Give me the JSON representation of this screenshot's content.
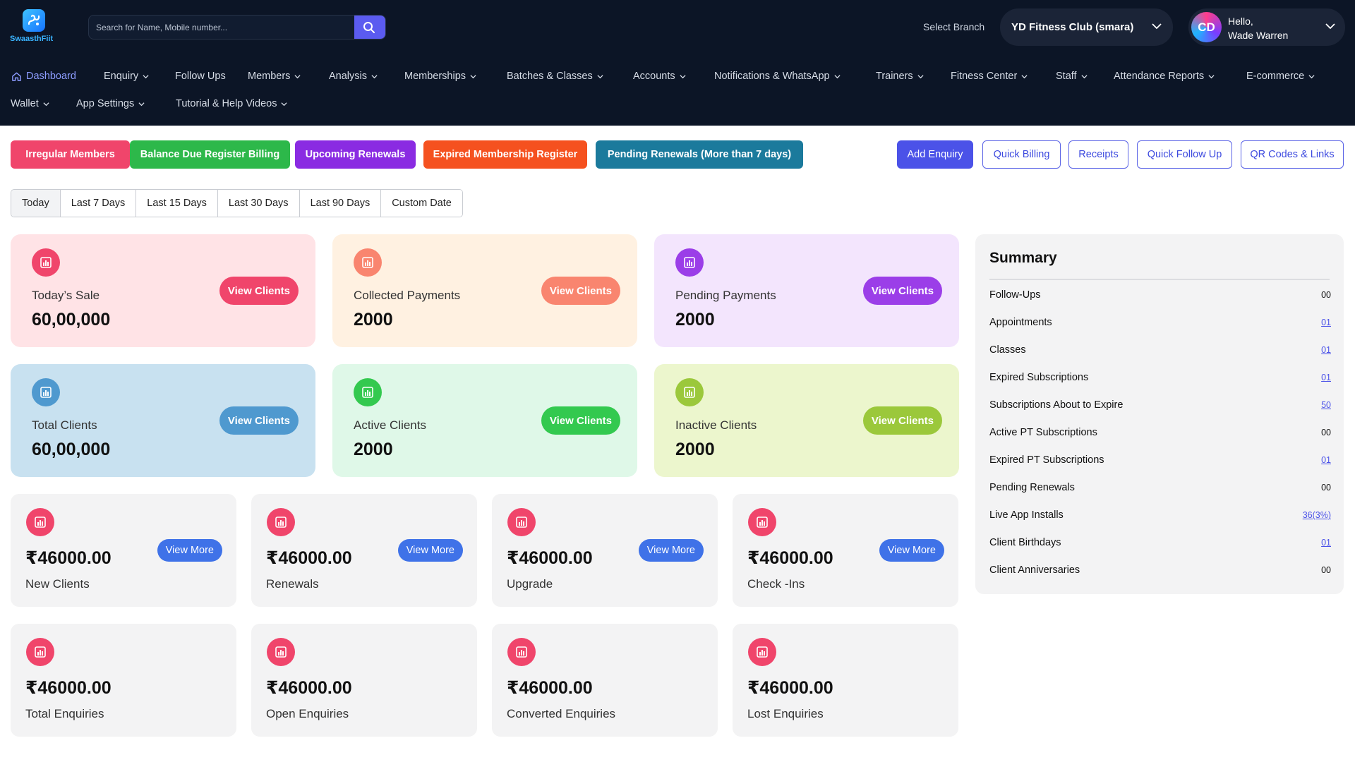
{
  "brand": {
    "name": "SwaasthFiit"
  },
  "search": {
    "placeholder": "Search for Name, Mobile number..."
  },
  "branch": {
    "label": "Select Branch",
    "value": "YD Fitness Club (smara)"
  },
  "user": {
    "initials": "CD",
    "greeting": "Hello,",
    "name": "Wade Warren"
  },
  "nav": [
    {
      "label": "Dashboard",
      "caret": false
    },
    {
      "label": "Enquiry",
      "caret": true
    },
    {
      "label": "Follow Ups",
      "caret": false
    },
    {
      "label": "Members",
      "caret": true
    },
    {
      "label": "Analysis",
      "caret": true
    },
    {
      "label": "Memberships",
      "caret": true
    },
    {
      "label": "Batches & Classes",
      "caret": true
    },
    {
      "label": "Accounts",
      "caret": true
    },
    {
      "label": "Notifications & WhatsApp",
      "caret": true
    },
    {
      "label": "Trainers",
      "caret": true
    },
    {
      "label": "Fitness Center",
      "caret": true
    },
    {
      "label": "Staff",
      "caret": true
    },
    {
      "label": "Attendance Reports",
      "caret": true
    },
    {
      "label": "E-commerce",
      "caret": true
    },
    {
      "label": "Wallet",
      "caret": true
    },
    {
      "label": "App Settings",
      "caret": true
    },
    {
      "label": "Tutorial & Help Videos",
      "caret": true
    }
  ],
  "quick_links": [
    {
      "label": "Irregular Members",
      "color": "#f0456b"
    },
    {
      "label": "Balance Due Register Billing",
      "color": "#2db84a"
    },
    {
      "label": "Upcoming Renewals",
      "color": "#8a2be2"
    },
    {
      "label": "Expired Membership Register",
      "color": "#f5511f"
    },
    {
      "label": "Pending Renewals (More than 7 days)",
      "color": "#1b7a9c"
    }
  ],
  "actions": [
    "Add Enquiry",
    "Quick Billing",
    "Receipts",
    "Quick Follow Up",
    "QR Codes & Links"
  ],
  "date_ranges": [
    "Today",
    "Last 7 Days",
    "Last 15 Days",
    "Last 30 Days",
    "Last 90 Days",
    "Custom Date"
  ],
  "stat_cards": [
    {
      "label": "Today’s Sale",
      "value": "60,00,000",
      "button": "View Clients",
      "bg": "#ffe3e6",
      "accent": "#f0456b"
    },
    {
      "label": "Collected Payments",
      "value": "2000",
      "button": "View Clients",
      "bg": "#fff1e1",
      "accent": "#f9856f"
    },
    {
      "label": "Pending Payments",
      "value": "2000",
      "button": "View Clients",
      "bg": "#f3e5fd",
      "accent": "#9b3ee8"
    },
    {
      "label": "Total Clients",
      "value": "60,00,000",
      "button": "View Clients",
      "bg": "#c8e1f0",
      "accent": "#4f99cf"
    },
    {
      "label": "Active Clients",
      "value": "2000",
      "button": "View Clients",
      "bg": "#dff8e8",
      "accent": "#33c94f"
    },
    {
      "label": "Inactive Clients",
      "value": "2000",
      "button": "View Clients",
      "bg": "#ecf6cd",
      "accent": "#9bc83b"
    }
  ],
  "money_cards": [
    {
      "amount": "₹46000.00",
      "label": "New Clients",
      "button": "View More"
    },
    {
      "amount": "₹46000.00",
      "label": "Renewals",
      "button": "View More"
    },
    {
      "amount": "₹46000.00",
      "label": "Upgrade",
      "button": "View More"
    },
    {
      "amount": "₹46000.00",
      "label": "Check -Ins",
      "button": "View More"
    },
    {
      "amount": "₹46000.00",
      "label": "Total Enquiries",
      "button": ""
    },
    {
      "amount": "₹46000.00",
      "label": "Open Enquiries",
      "button": ""
    },
    {
      "amount": "₹46000.00",
      "label": "Converted Enquiries",
      "button": ""
    },
    {
      "amount": "₹46000.00",
      "label": "Lost Enquiries",
      "button": ""
    }
  ],
  "summary": {
    "title": "Summary",
    "rows": [
      {
        "label": "Follow-Ups",
        "value": "00",
        "link": false
      },
      {
        "label": "Appointments",
        "value": "01",
        "link": true
      },
      {
        "label": "Classes",
        "value": "01",
        "link": true
      },
      {
        "label": "Expired Subscriptions",
        "value": "01",
        "link": true
      },
      {
        "label": "Subscriptions About to Expire",
        "value": "50",
        "link": true
      },
      {
        "label": "Active PT Subscriptions",
        "value": "00",
        "link": false
      },
      {
        "label": "Expired PT Subscriptions",
        "value": "01",
        "link": true
      },
      {
        "label": "Pending Renewals",
        "value": "00",
        "link": false
      },
      {
        "label": "Live App Installs",
        "value": "36(3%)",
        "link": true
      },
      {
        "label": "Client Birthdays",
        "value": "01",
        "link": true
      },
      {
        "label": "Client Anniversaries",
        "value": "00",
        "link": false
      }
    ]
  },
  "icons": {
    "logo": "app-logo-icon",
    "search": "search-icon",
    "home": "home-icon",
    "chevron": "chevron-down-icon",
    "card": "bar-chart-icon"
  }
}
